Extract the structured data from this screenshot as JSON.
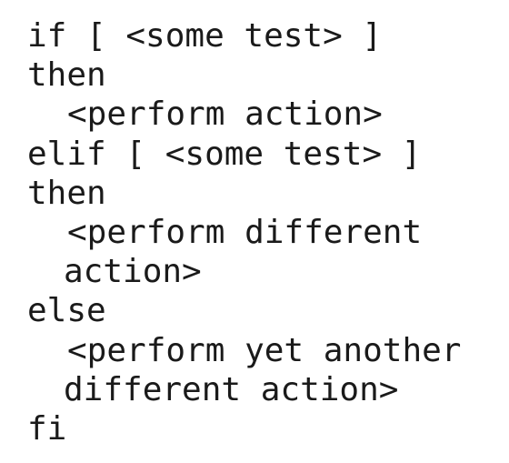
{
  "code": {
    "lines": [
      "if [ <some test> ]",
      "then",
      "<perform action>",
      "elif [ <some test> ]",
      "then",
      "<perform different",
      "action>",
      "else",
      "<perform yet another",
      "different action>",
      "fi"
    ]
  }
}
